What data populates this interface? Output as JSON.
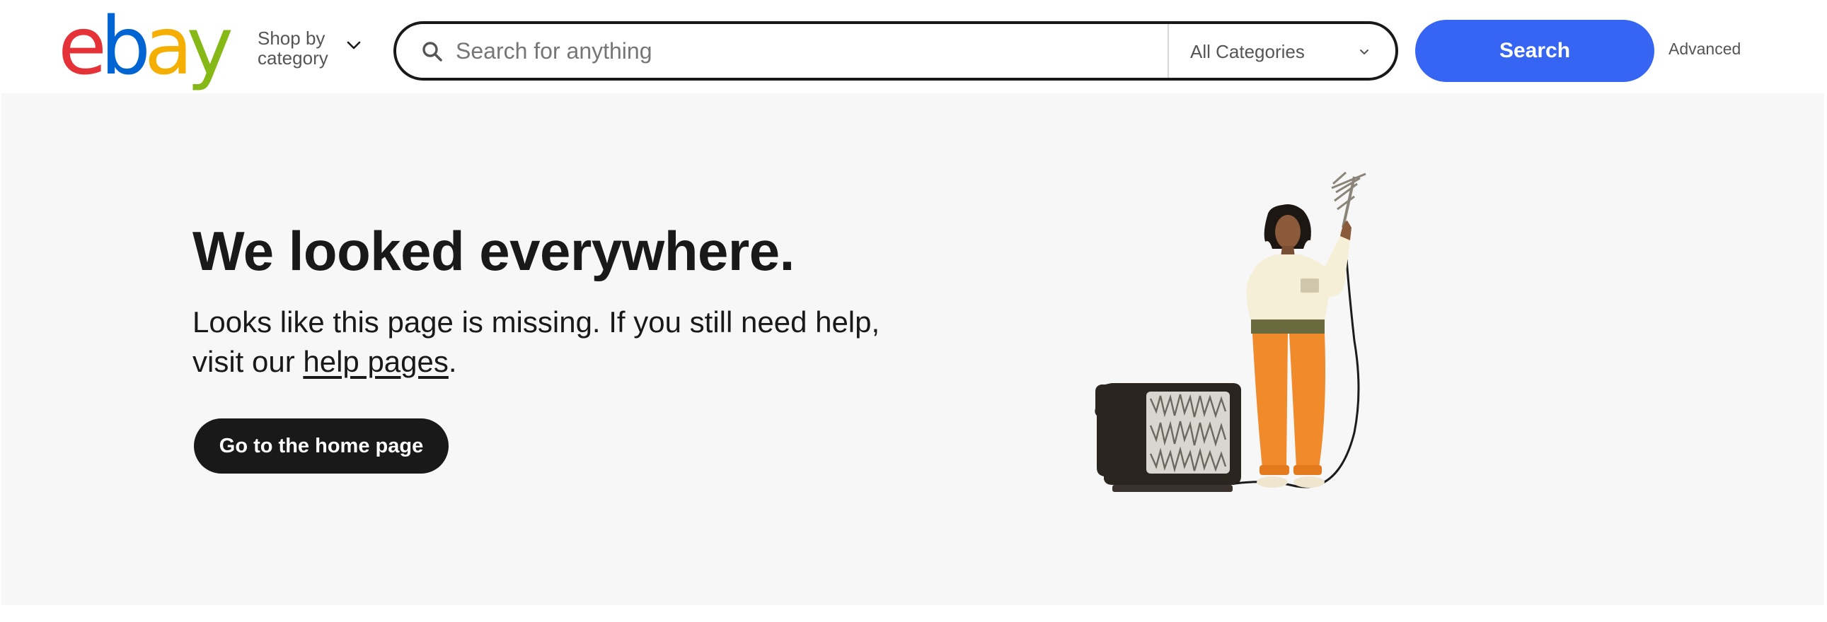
{
  "header": {
    "logo_letters": [
      "e",
      "b",
      "a",
      "y"
    ],
    "logo_colors": [
      "#e53238",
      "#0064d2",
      "#f5af02",
      "#86b817"
    ],
    "shop_by_label": "Shop by\ncategory",
    "shop_by_icon": "chevron-down-icon",
    "search": {
      "icon": "search-icon",
      "placeholder": "Search for anything",
      "value": ""
    },
    "category_select": {
      "selected": "All Categories",
      "icon": "chevron-down-icon"
    },
    "search_button_label": "Search",
    "advanced_link": "Advanced"
  },
  "main": {
    "headline": "We looked everywhere.",
    "body_before_link": "Looks like this page is missing. If you still need help, visit our ",
    "help_link": "help pages",
    "body_after_link": ".",
    "home_button_label": "Go to the home page",
    "illustration": "person-with-antenna-and-tv-illustration"
  },
  "colors": {
    "accent_blue": "#3665f3",
    "dark": "#191919",
    "band_gray": "#f7f7f7"
  }
}
